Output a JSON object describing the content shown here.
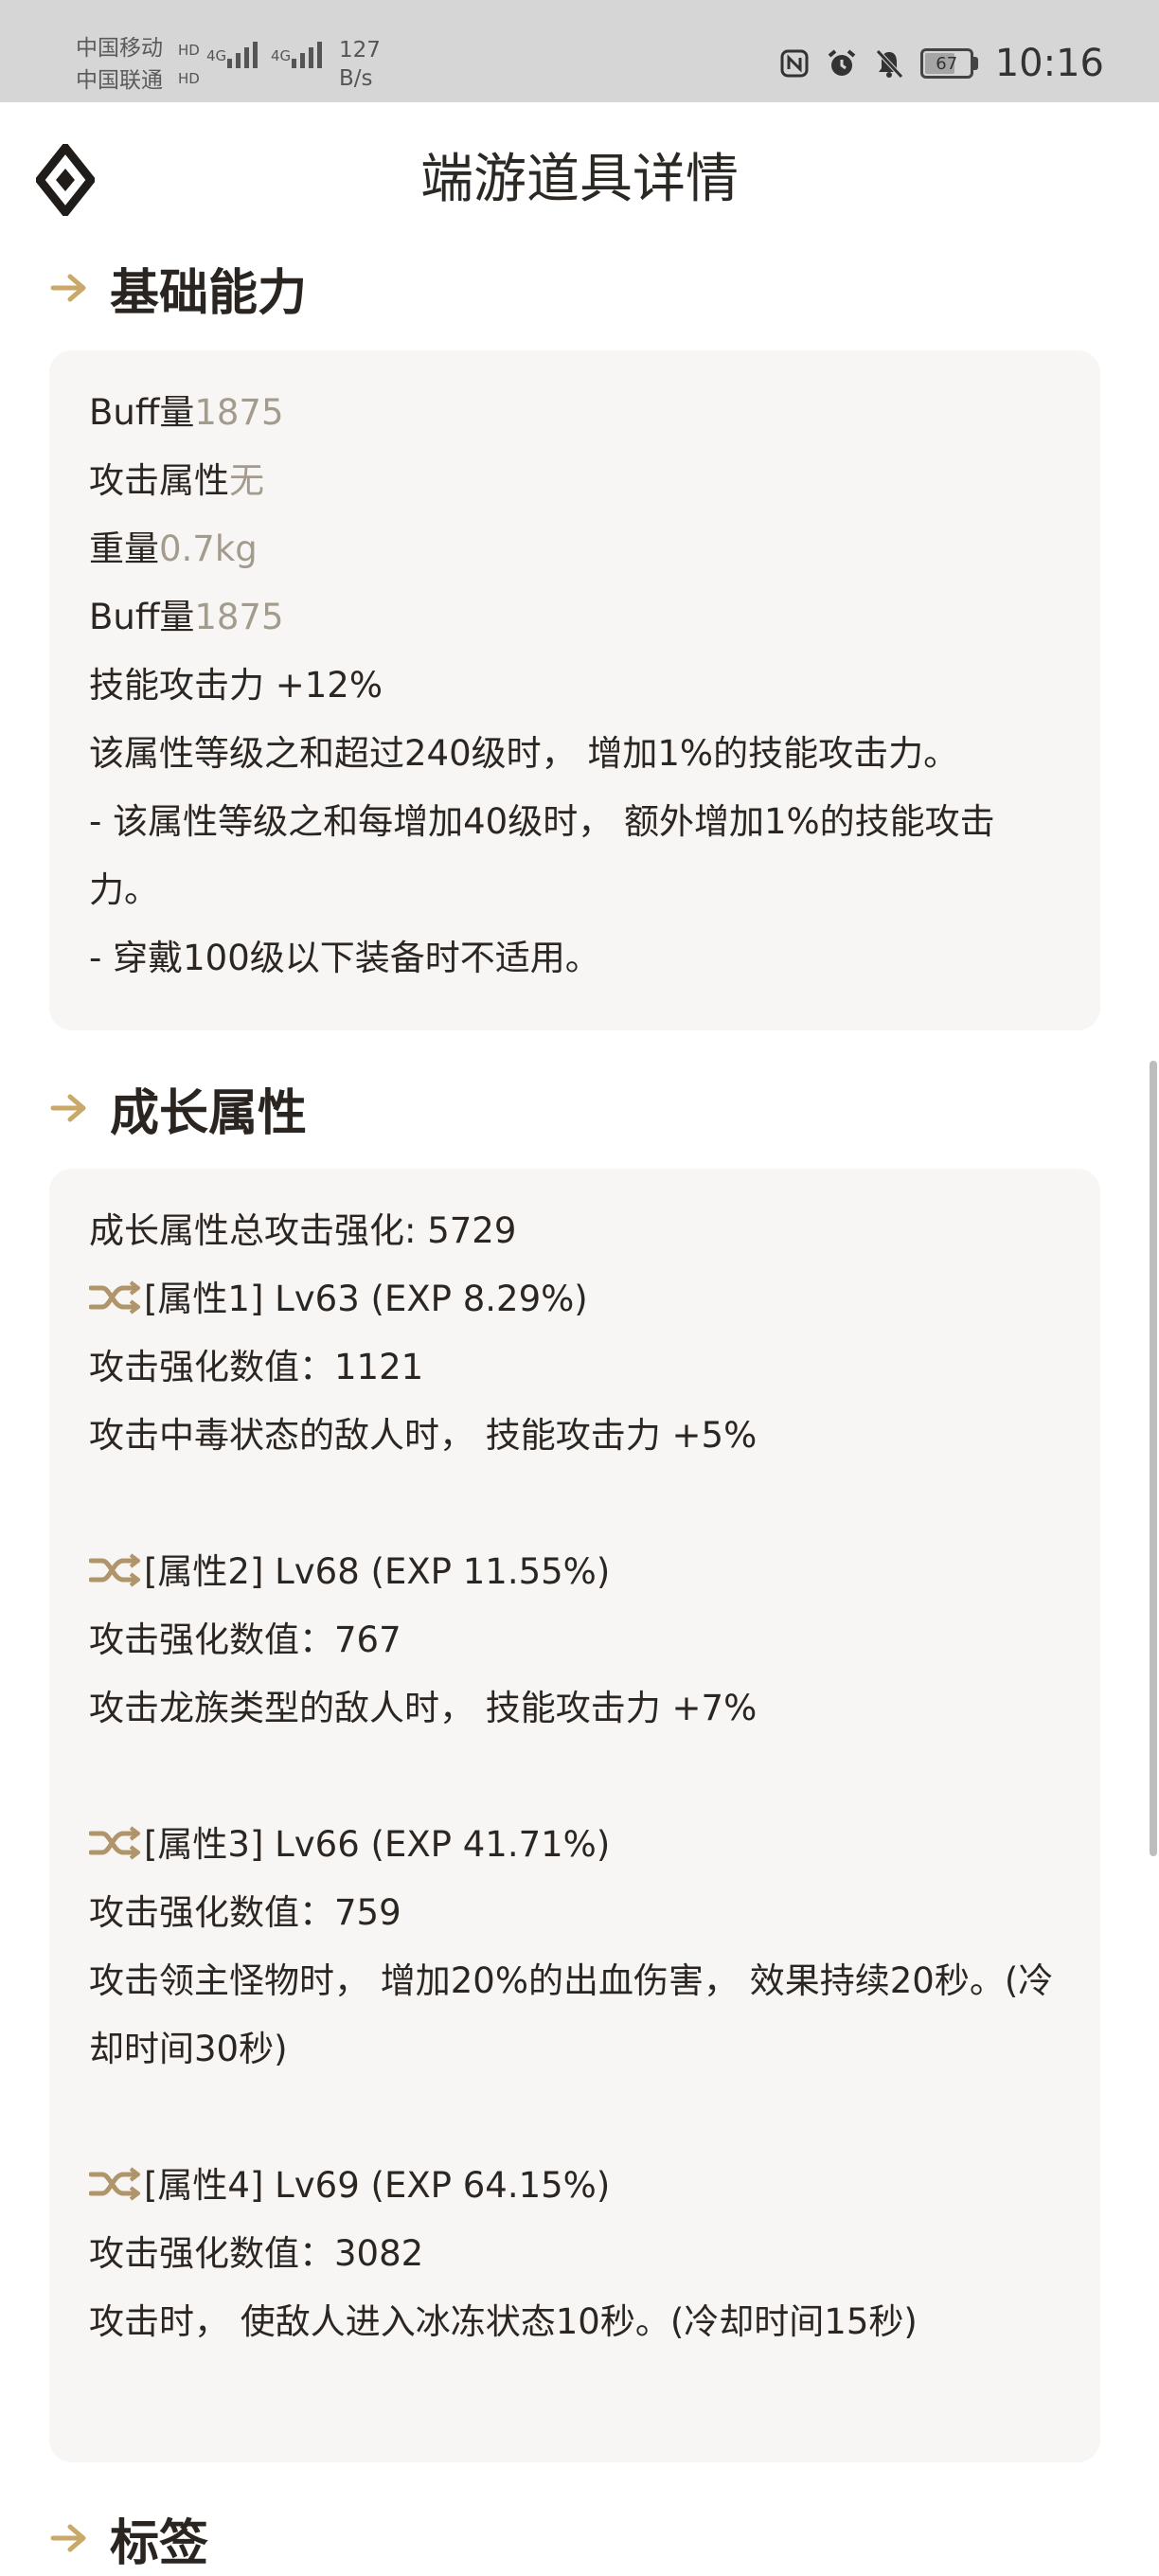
{
  "status_bar": {
    "carrier_1": "中国移动",
    "carrier_2": "中国联通",
    "net_1": "4G",
    "net_2": "4G",
    "speed_value": "127",
    "speed_unit": "B/s",
    "battery": "67",
    "time": "10:16"
  },
  "header": {
    "title": "端游道具详情"
  },
  "basic_section": {
    "title": "基础能力",
    "lines": [
      {
        "label": "Buff量",
        "value": "1875"
      },
      {
        "label": "攻击属性",
        "value": "无"
      },
      {
        "label": "重量",
        "value": "0.7kg"
      },
      {
        "label": "Buff量",
        "value": "1875"
      }
    ],
    "text_lines": [
      "技能攻击力 +12%",
      "该属性等级之和超过240级时， 增加1%的技能攻击力。",
      "- 该属性等级之和每增加40级时， 额外增加1%的技能攻击力。",
      "- 穿戴100级以下装备时不适用。"
    ]
  },
  "growth_section": {
    "title": "成长属性",
    "total": "成长属性总攻击强化: 5729",
    "attributes": [
      {
        "header": "[属性1] Lv63 (EXP 8.29%)",
        "value": "攻击强化数值：1121",
        "effect": "攻击中毒状态的敌人时， 技能攻击力 +5%"
      },
      {
        "header": "[属性2] Lv68 (EXP 11.55%)",
        "value": "攻击强化数值：767",
        "effect": "攻击龙族类型的敌人时， 技能攻击力 +7%"
      },
      {
        "header": "[属性3] Lv66 (EXP 41.71%)",
        "value": "攻击强化数值：759",
        "effect": "攻击领主怪物时， 增加20%的出血伤害， 效果持续20秒。(冷却时间30秒)"
      },
      {
        "header": "[属性4] Lv69 (EXP 64.15%)",
        "value": "攻击强化数值：3082",
        "effect": "攻击时， 使敌人进入冰冻状态10秒。(冷却时间15秒)"
      }
    ]
  },
  "tags_section": {
    "title": "标签"
  },
  "colors": {
    "accent": "#c9a86a",
    "muted_value": "#a39b8d",
    "card_bg": "#f8f6f4",
    "status_bar_bg": "#d6d6d6"
  },
  "icons": {
    "logo": "diamond-logo-icon",
    "section": "arrow-right-icon",
    "attribute": "shuffle-icon"
  }
}
